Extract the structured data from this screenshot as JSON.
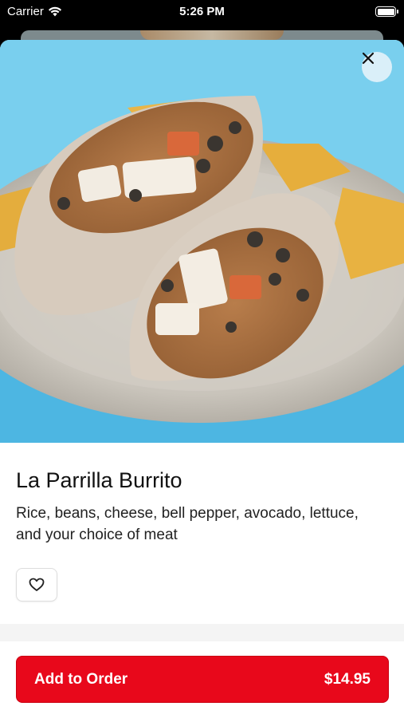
{
  "status_bar": {
    "carrier": "Carrier",
    "time": "5:26 PM",
    "icons": [
      "wifi-icon",
      "battery-icon"
    ]
  },
  "item": {
    "name": "La Parrilla Burrito",
    "description": "Rice, beans, cheese, bell pepper, avocado, lettuce, and your choice of meat",
    "image_alt": "burrito-photo"
  },
  "actions": {
    "close_icon": "close-icon",
    "favorite_icon": "heart-icon",
    "add_label": "Add to Order",
    "price": "$14.95"
  },
  "colors": {
    "accent": "#e8081b",
    "hero_background": "#79cfee"
  }
}
